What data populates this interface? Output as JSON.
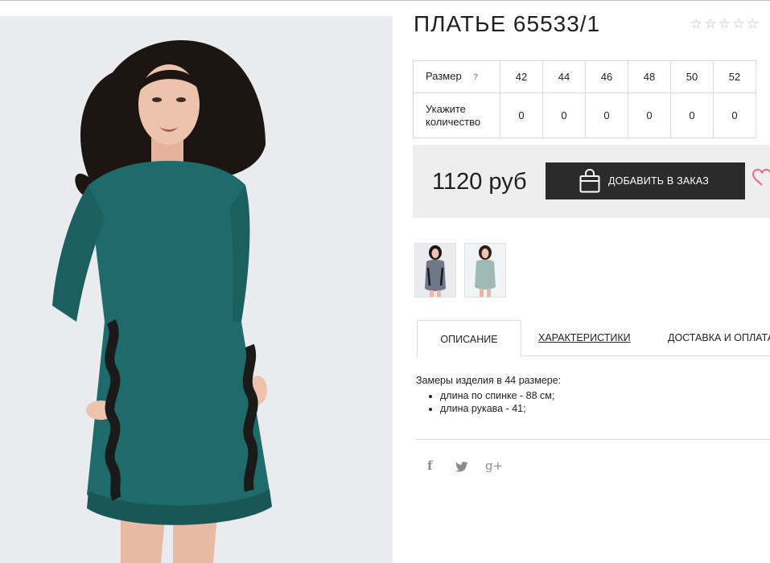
{
  "product": {
    "title": "ПЛАТЬЕ 65533/1",
    "rating": {
      "stars_filled": 0,
      "stars_total": 5,
      "star_glyph": "☆"
    }
  },
  "sizes_table": {
    "size_label": "Размер",
    "help": "?",
    "sizes": [
      "42",
      "44",
      "46",
      "48",
      "50",
      "52"
    ],
    "qty_label": [
      "Укажите",
      "количество"
    ],
    "quantities": [
      "0",
      "0",
      "0",
      "0",
      "0",
      "0"
    ]
  },
  "purchase": {
    "price": "1120 руб",
    "add_button": "ДОБАВИТЬ В ЗАКАЗ",
    "bag_icon": "shopping-bag-icon",
    "heart_icon": "heart-icon"
  },
  "gallery": {
    "thumbnails": [
      "thumbnail-1",
      "thumbnail-2"
    ]
  },
  "tabs": [
    "ОПИСАНИЕ",
    "ХАРАКТЕРИСТИКИ",
    "ДОСТАВКА И ОПЛАТА"
  ],
  "description": {
    "intro": "Замеры изделия в 44 размере:",
    "items": [
      "длина по спинке - 88 см;",
      "длина рукава - 41;"
    ]
  },
  "social": {
    "facebook": "f",
    "twitter": "twitter-icon",
    "gplus": "g+"
  },
  "colors": {
    "dress": "#1f6a6a",
    "button": "#2b2b2b",
    "price_bg": "#eeeeee",
    "heart": "#e96a8e",
    "star": "#bdbdbd"
  }
}
